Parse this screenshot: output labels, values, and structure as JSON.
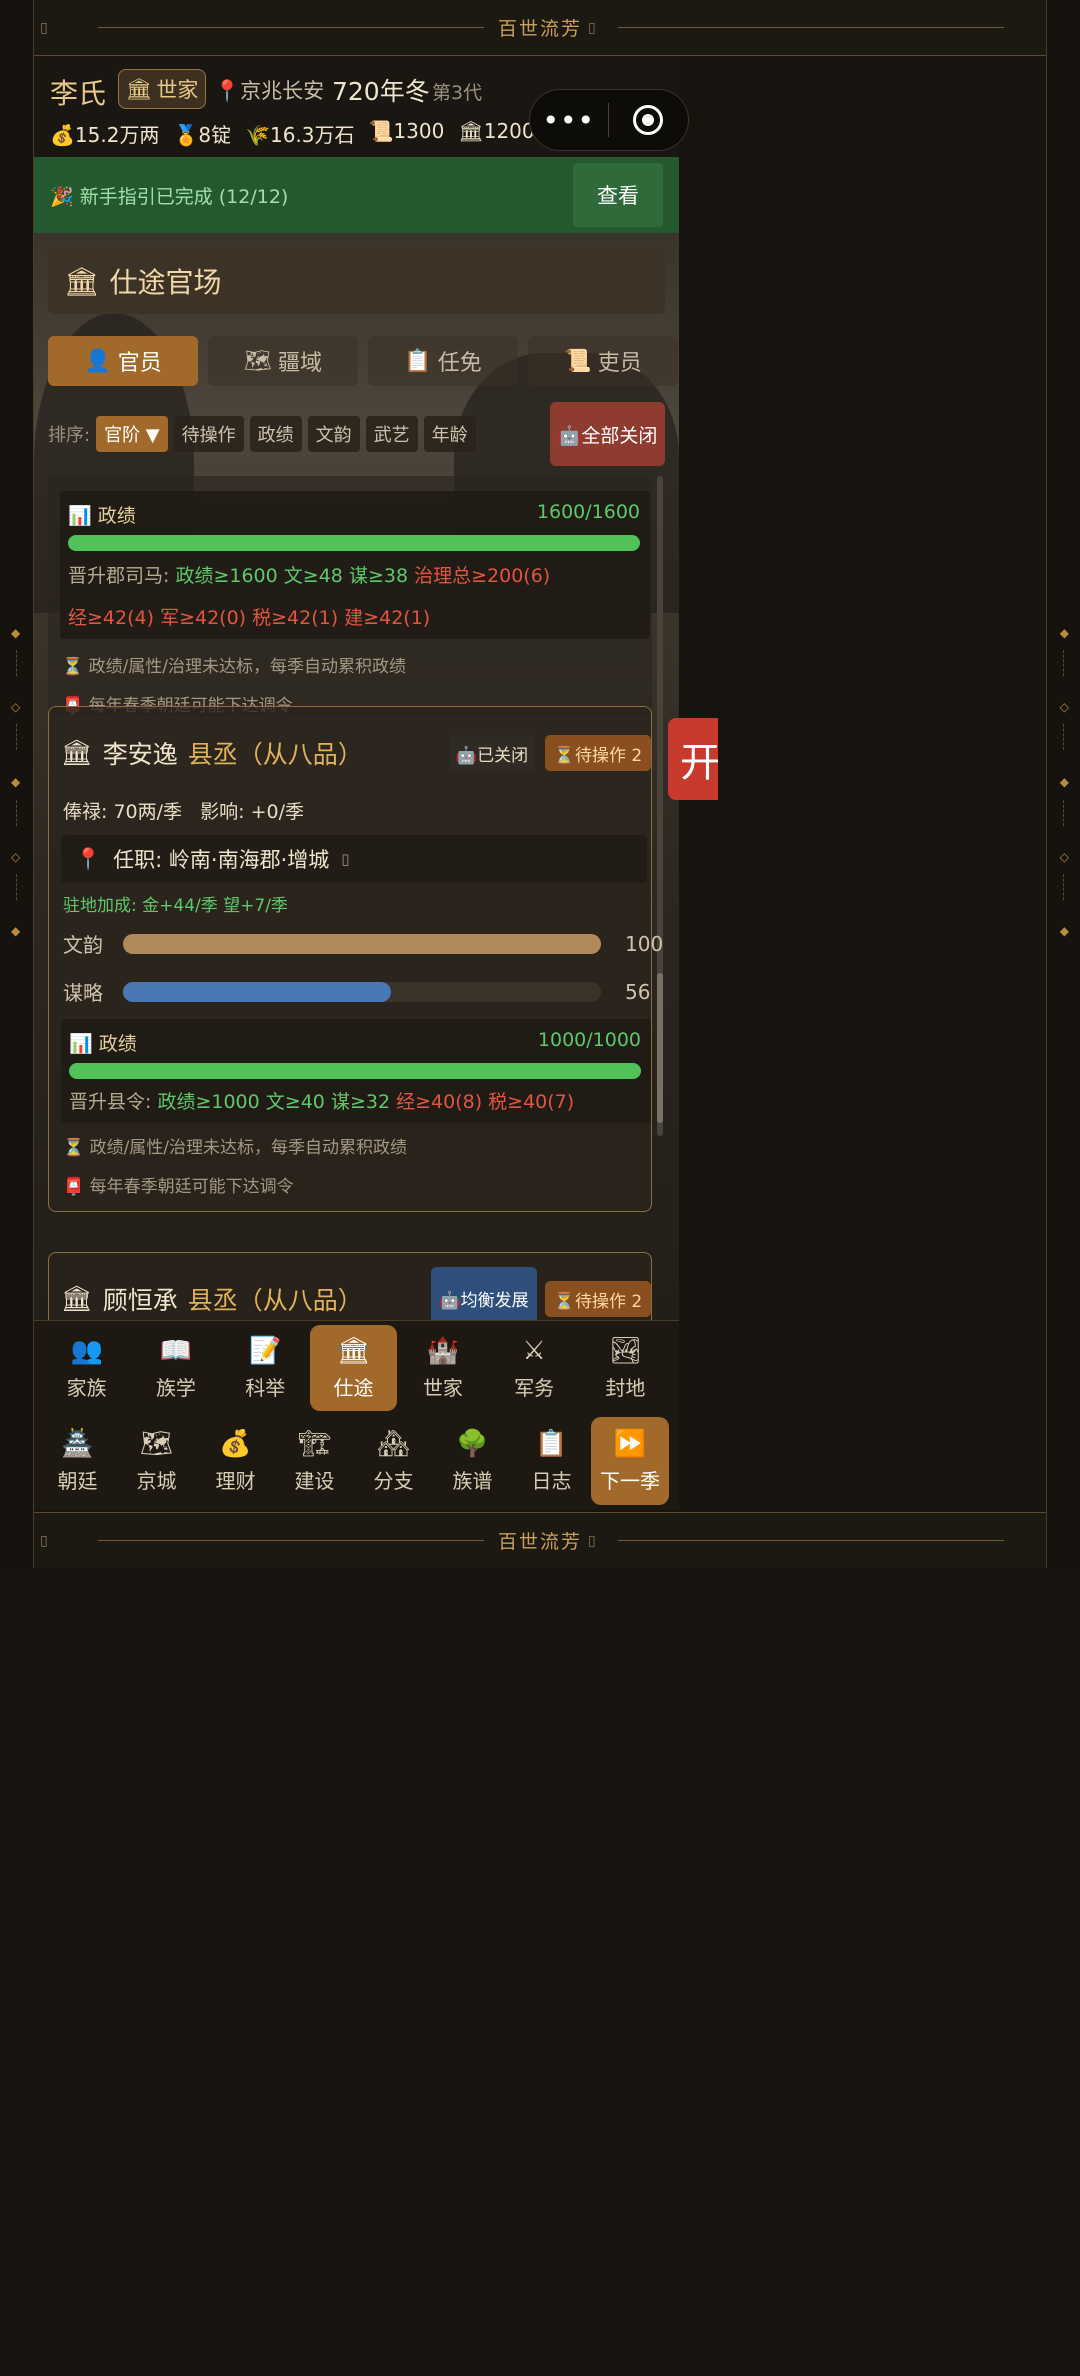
{
  "banner": {
    "title": "百世流芳",
    "bracket_left": "▯",
    "bracket_right": "▯"
  },
  "header": {
    "family_name": "李氏",
    "badge_icon": "🏛",
    "badge_label": "世家",
    "location_icon": "📍",
    "location": "京兆长安",
    "year": "720年冬",
    "generation": "第3代",
    "resources": [
      {
        "icon": "💰",
        "value": "15.2万两"
      },
      {
        "icon": "🏅",
        "value": "8锭"
      },
      {
        "icon": "🌾",
        "value": "16.3万石"
      },
      {
        "icon": "📜",
        "value": "1300"
      },
      {
        "icon": "🏛",
        "value": "1200"
      }
    ],
    "capsule_dots": "•••"
  },
  "guide": {
    "icon": "🎉",
    "text": "新手指引已完成 (12/12)",
    "button": "查看"
  },
  "panel": {
    "icon": "🏛",
    "title": "仕途官场"
  },
  "tabs": [
    {
      "icon": "👤",
      "label": "官员",
      "active": true
    },
    {
      "icon": "🗺",
      "label": "疆域",
      "active": false
    },
    {
      "icon": "📋",
      "label": "任免",
      "active": false
    },
    {
      "icon": "📜",
      "label": "吏员",
      "active": false
    }
  ],
  "sort": {
    "label": "排序:",
    "options": [
      "官阶 ▼",
      "待操作",
      "政绩",
      "文韵",
      "武艺",
      "年龄"
    ],
    "close_all": "🤖全部关闭"
  },
  "card0": {
    "perf_icon": "📊",
    "perf_label": "政绩",
    "perf_value": "1600/1600",
    "perf_fill": 1.0,
    "req_line1": {
      "prefix": "晋升郡司马:",
      "items_green": [
        "政绩≥1600",
        "文≥48",
        "谋≥38"
      ],
      "items_red": [
        "治理总≥200(6)"
      ]
    },
    "req_line2": {
      "items_red": [
        "经≥42(4)",
        "军≥42(0)",
        "税≥42(1)",
        "建≥42(1)"
      ]
    },
    "note1": "⏳ 政绩/属性/治理未达标，每季自动累积政绩",
    "note2": "📮 每年春季朝廷可能下达调令"
  },
  "card1": {
    "icon": "🏛",
    "name": "李安逸",
    "rank": "县丞（从八品）",
    "auto": "🤖已关闭",
    "pending": "⏳待操作 2",
    "salary": "俸禄: 70两/季",
    "influence": "影响: +0/季",
    "post_icon": "📍",
    "post": "任职: 岭南·南海郡·增城",
    "post_tail": "▯",
    "bonus": "驻地加成: 金+44/季  望+7/季",
    "stats": [
      {
        "label": "文韵",
        "value": "100",
        "fill": 1.0,
        "color": "#b08a5c"
      },
      {
        "label": "谋略",
        "value": "56",
        "fill": 0.56,
        "color": "#4a78b4"
      }
    ],
    "perf_icon": "📊",
    "perf_label": "政绩",
    "perf_value": "1000/1000",
    "perf_fill": 1.0,
    "req": {
      "prefix": "晋升县令:",
      "items_green": [
        "政绩≥1000",
        "文≥40",
        "谋≥32"
      ],
      "items_red": [
        "经≥40(8)",
        "税≥40(7)"
      ]
    },
    "note1": "⏳ 政绩/属性/治理未达标，每季自动累积政绩",
    "note2": "📮 每年春季朝廷可能下达调令"
  },
  "card2": {
    "icon": "🏛",
    "name": "顾恒承",
    "rank": "县丞（从八品）",
    "auto": "🤖均衡发展",
    "pending": "⏳待操作 2"
  },
  "nav_row1": [
    {
      "icon": "👥",
      "label": "家族",
      "active": false
    },
    {
      "icon": "📖",
      "label": "族学",
      "active": false
    },
    {
      "icon": "📝",
      "label": "科举",
      "active": false
    },
    {
      "icon": "🏛",
      "label": "仕途",
      "active": true
    },
    {
      "icon": "🏰",
      "label": "世家",
      "active": false
    },
    {
      "icon": "⚔",
      "label": "军务",
      "active": false
    },
    {
      "icon": "🏞",
      "label": "封地",
      "active": false
    }
  ],
  "nav_row2": [
    {
      "icon": "🏯",
      "label": "朝廷",
      "active": false
    },
    {
      "icon": "🗺",
      "label": "京城",
      "active": false
    },
    {
      "icon": "💰",
      "label": "理财",
      "active": false
    },
    {
      "icon": "🏗",
      "label": "建设",
      "active": false
    },
    {
      "icon": "🏘",
      "label": "分支",
      "active": false
    },
    {
      "icon": "🌳",
      "label": "族谱",
      "active": false
    },
    {
      "icon": "📋",
      "label": "日志",
      "active": false
    },
    {
      "icon": "⏩",
      "label": "下一季",
      "active": true
    }
  ],
  "side_tab": "开"
}
